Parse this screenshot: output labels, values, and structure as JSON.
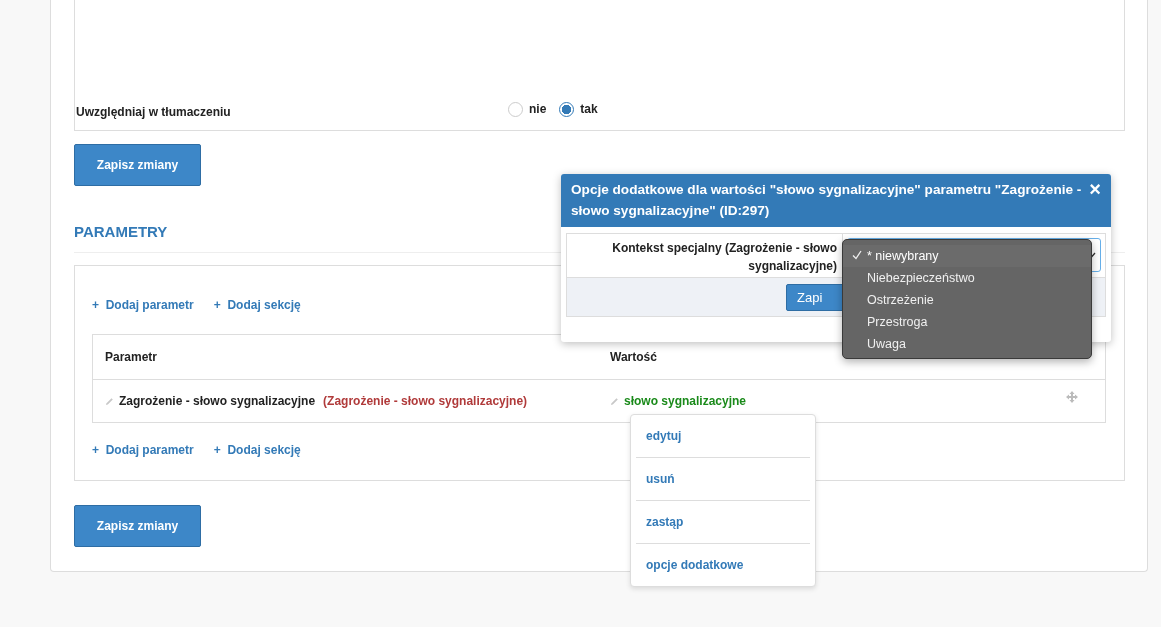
{
  "translation_option": {
    "label": "Uwzględniaj w tłumaczeniu",
    "options": [
      {
        "label": "nie",
        "selected": false
      },
      {
        "label": "tak",
        "selected": true
      }
    ]
  },
  "save_button_top": "Zapisz zmiany",
  "section_title": "PARAMETRY",
  "links_top": [
    {
      "icon": "+",
      "label": "Dodaj parametr"
    },
    {
      "icon": "+",
      "label": "Dodaj sekcję"
    }
  ],
  "table": {
    "columns": [
      "Parametr",
      "Wartość"
    ],
    "rows": [
      {
        "parameter": "Zagrożenie - słowo sygnalizacyjne",
        "parameter_note": "(Zagrożenie - słowo sygnalizacyjne)",
        "value": "słowo sygnalizacyjne"
      }
    ]
  },
  "links_bottom": [
    {
      "icon": "+",
      "label": "Dodaj parametr"
    },
    {
      "icon": "+",
      "label": "Dodaj sekcję"
    }
  ],
  "save_button_bottom": "Zapisz zmiany",
  "modal": {
    "title": "Opcje dodatkowe dla wartości \"słowo sygnalizacyjne\" parametru \"Zagrożenie - słowo sygnalizacyjne\" (ID:297)",
    "close": "×",
    "field_label": "Kontekst specjalny (Zagrożenie - słowo sygnalizacyjne)",
    "save_button": "Zapi"
  },
  "dropdown": {
    "options": [
      {
        "label": "* niewybrany",
        "selected": true
      },
      {
        "label": "Niebezpieczeństwo",
        "selected": false
      },
      {
        "label": "Ostrzeżenie",
        "selected": false
      },
      {
        "label": "Przestroga",
        "selected": false
      },
      {
        "label": "Uwaga",
        "selected": false
      }
    ]
  },
  "context_menu": [
    "edytuj",
    "usuń",
    "zastąp",
    "opcje dodatkowe"
  ]
}
